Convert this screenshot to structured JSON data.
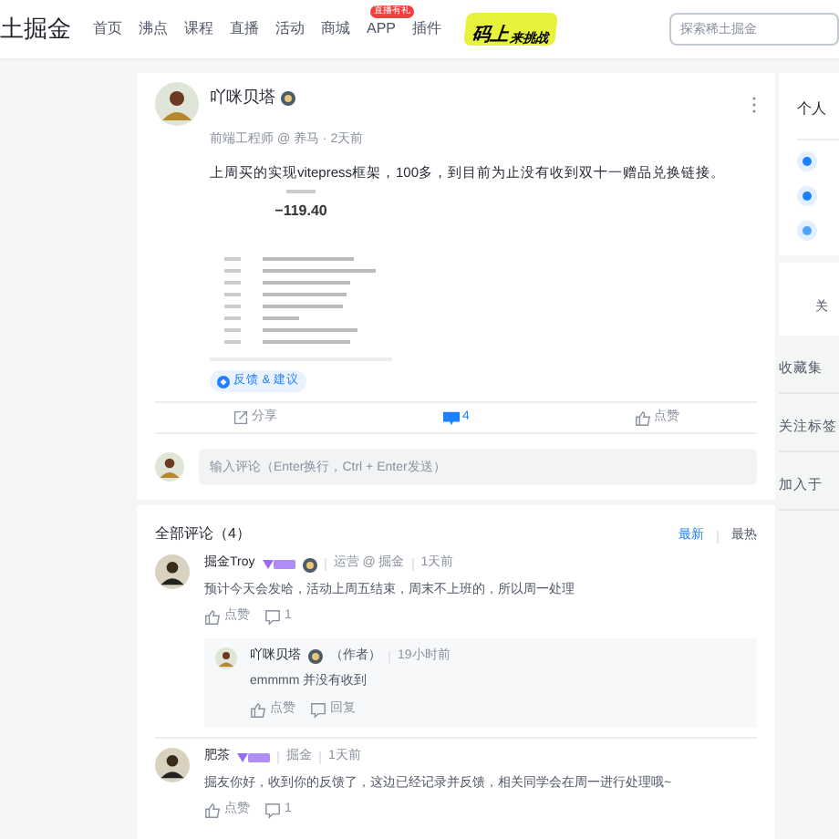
{
  "nav": {
    "logo": "土掘金",
    "items": [
      {
        "label": "首页",
        "selected": false
      },
      {
        "label": "沸点",
        "selected": false
      },
      {
        "label": "课程",
        "selected": false
      },
      {
        "label": "直播",
        "selected": false
      },
      {
        "label": "活动",
        "selected": false
      },
      {
        "label": "商城",
        "selected": false
      },
      {
        "label": "APP",
        "selected": false,
        "badge": "直播有礼"
      },
      {
        "label": "插件",
        "selected": false
      }
    ],
    "banner": {
      "line1": "码上",
      "line2": "来挑战"
    },
    "search": {
      "placeholder": "探索稀土掘金"
    }
  },
  "post": {
    "author": "吖咪贝塔",
    "meta": "前端工程师 @ 养马 · 2天前",
    "text": "上周买的实现vitepress框架，100多，到目前为止没有收到双十一赠品兑换链接。",
    "amount": "−119.40",
    "feedback": "反馈 & 建议",
    "actions": [
      {
        "kind": "share",
        "label": "分享",
        "selected": false
      },
      {
        "kind": "comment",
        "label": "4",
        "selected": true
      },
      {
        "kind": "like",
        "label": "点赞",
        "selected": false
      }
    ],
    "comment_input": {
      "placeholder": "输入评论（Enter换行，Ctrl + Enter发送）"
    }
  },
  "comments": {
    "title": "全部评论（4）",
    "sorts": [
      {
        "label": "最新",
        "selected": true
      },
      {
        "label": "最热",
        "selected": false
      }
    ],
    "items": [
      {
        "name": "掘金Troy",
        "position": "运营 @ 掘金",
        "time": "1天前",
        "text": "预计今天会发哈，活动上周五结束，周末不上班的，所以周一处理",
        "like": "点赞",
        "reply_count": "1",
        "replies": [
          {
            "name": "吖咪贝塔",
            "tag": "（作者）",
            "time": "19小时前",
            "text": "emmmm 并没有收到",
            "like": "点赞",
            "reply": "回复"
          }
        ]
      },
      {
        "name": "肥茶",
        "position": "掘金",
        "time": "1天前",
        "text": "掘友你好，收到你的反馈了，这边已经记录并反馈，相关同学会在周一进行处理哦~",
        "like": "点赞",
        "reply_count": "1"
      }
    ]
  },
  "sidebar": {
    "title": "个人",
    "follow": "关",
    "links": [
      "收藏集",
      "关注标签",
      "加入于"
    ]
  }
}
